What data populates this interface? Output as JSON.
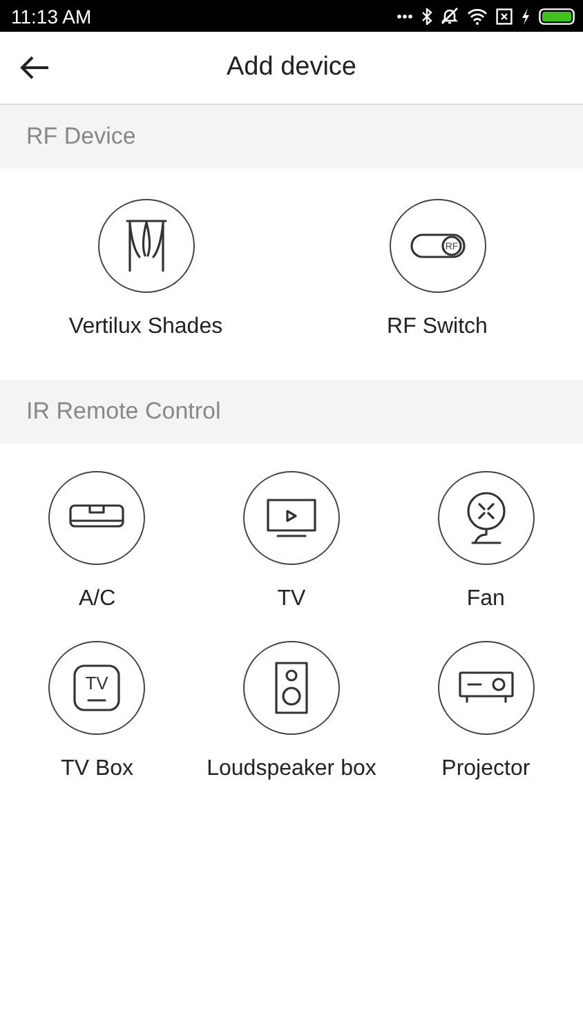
{
  "status_bar": {
    "time": "11:13 AM"
  },
  "header": {
    "title": "Add device"
  },
  "sections": [
    {
      "title": "RF Device",
      "devices": [
        {
          "kind": "curtain",
          "label": "Vertilux Shades"
        },
        {
          "kind": "switch",
          "label": "RF Switch",
          "icon_text": "RF"
        }
      ]
    },
    {
      "title": "IR Remote Control",
      "devices": [
        {
          "kind": "ac",
          "label": "A/C"
        },
        {
          "kind": "tv",
          "label": "TV"
        },
        {
          "kind": "fan",
          "label": "Fan"
        },
        {
          "kind": "tvbox",
          "label": "TV Box",
          "icon_text": "TV"
        },
        {
          "kind": "speaker",
          "label": "Loudspeaker box"
        },
        {
          "kind": "projector",
          "label": "Projector"
        }
      ]
    }
  ]
}
